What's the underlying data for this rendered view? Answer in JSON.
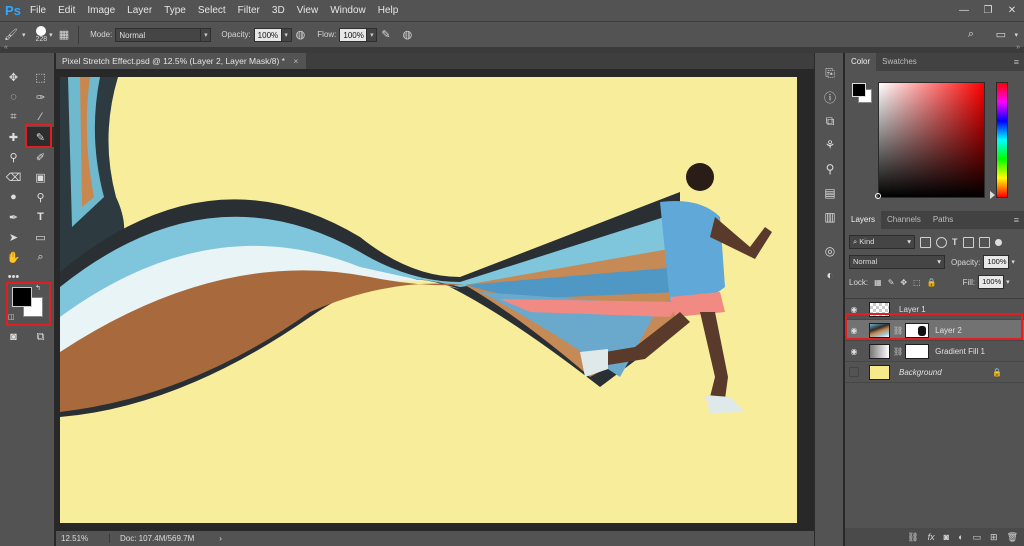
{
  "app": {
    "logo": "Ps"
  },
  "menu": [
    "File",
    "Edit",
    "Image",
    "Layer",
    "Type",
    "Select",
    "Filter",
    "3D",
    "View",
    "Window",
    "Help"
  ],
  "window_controls": {
    "minimize": "—",
    "restore": "❐",
    "close": "✕"
  },
  "options": {
    "brush_size": "228",
    "mode_label": "Mode:",
    "mode_value": "Normal",
    "opacity_label": "Opacity:",
    "opacity_value": "100%",
    "flow_label": "Flow:",
    "flow_value": "100%"
  },
  "document": {
    "tab_title": "Pixel Stretch Effect.psd @ 12.5% (Layer 2, Layer Mask/8) *",
    "close_glyph": "×"
  },
  "status": {
    "zoom": "12.51%",
    "doc_info": "Doc: 107.4M/569.7M",
    "arrow": "›"
  },
  "color_panel": {
    "tabs": [
      "Color",
      "Swatches"
    ],
    "menu_glyph": "≡"
  },
  "layers_panel": {
    "tabs": [
      "Layers",
      "Channels",
      "Paths"
    ],
    "kind_label": "Kind",
    "blend_mode": "Normal",
    "opacity_label": "Opacity:",
    "opacity_value": "100%",
    "lock_label": "Lock:",
    "fill_label": "Fill:",
    "fill_value": "100%",
    "layers": [
      {
        "name": "Layer 1",
        "visible": true
      },
      {
        "name": "Layer 2",
        "visible": true,
        "selected": true
      },
      {
        "name": "Gradient Fill 1",
        "visible": true
      },
      {
        "name": "Background",
        "visible": false,
        "locked": true
      }
    ],
    "footer_icons": [
      "link-icon",
      "fx-icon",
      "mask-icon",
      "adjustment-icon",
      "group-icon",
      "new-layer-icon",
      "trash-icon"
    ]
  },
  "highlight_color": "#e02020",
  "accent_color": "#31a8ff"
}
